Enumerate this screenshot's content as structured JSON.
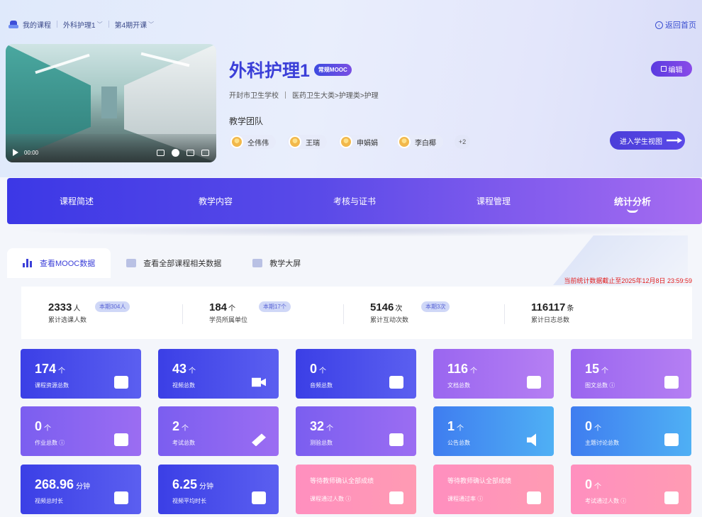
{
  "breadcrumb": {
    "my_courses": "我的课程",
    "course": "外科护理1",
    "term": "第4期开课",
    "back_home": "返回首页"
  },
  "video": {
    "time": "00:00"
  },
  "course": {
    "title": "外科护理1",
    "tag": "常规MOOC",
    "school": "开封市卫生学校",
    "category": "医药卫生大类>护理类>护理",
    "team_label": "教学团队",
    "members": [
      "仝伟伟",
      "王瑞",
      "申娟娟",
      "李白椰"
    ],
    "more_count": "+2",
    "edit_label": "编辑",
    "student_view_label": "进入学生视图"
  },
  "nav": {
    "items": [
      "课程简述",
      "教学内容",
      "考核与证书",
      "课程管理",
      "统计分析"
    ],
    "active_index": 4
  },
  "tabs": {
    "items": [
      "查看MOOC数据",
      "查看全部课程相关数据",
      "教学大屏"
    ],
    "active_index": 0
  },
  "stat_time": "当前统计数据截止至2025年12月8日 23:59:59",
  "summary": [
    {
      "value": "2333",
      "unit": "人",
      "label": "累计选课人数",
      "badge": "本期304人"
    },
    {
      "value": "184",
      "unit": "个",
      "label": "学员所属单位",
      "badge": "本期17个"
    },
    {
      "value": "5146",
      "unit": "次",
      "label": "累计互动次数",
      "badge": "本期3次"
    },
    {
      "value": "116117",
      "unit": "条",
      "label": "累计日志总数",
      "badge": ""
    }
  ],
  "cards": [
    {
      "value": "174",
      "unit": "个",
      "label": "课程资源总数",
      "theme": "blue",
      "icon": "pie-icon"
    },
    {
      "value": "43",
      "unit": "个",
      "label": "视频总数",
      "theme": "blue",
      "icon": "video-camera-icon"
    },
    {
      "value": "0",
      "unit": "个",
      "label": "音频总数",
      "theme": "blue",
      "icon": "music-note-icon"
    },
    {
      "value": "116",
      "unit": "个",
      "label": "文档总数",
      "theme": "violet",
      "icon": "word-doc-icon"
    },
    {
      "value": "15",
      "unit": "个",
      "label": "图文总数 ⓘ",
      "theme": "violet",
      "icon": "image-text-icon"
    },
    {
      "value": "0",
      "unit": "个",
      "label": "作业总数 ⓘ",
      "theme": "purple",
      "icon": "homework-edit-icon"
    },
    {
      "value": "2",
      "unit": "个",
      "label": "考试总数",
      "theme": "purple",
      "icon": "pen-icon"
    },
    {
      "value": "32",
      "unit": "个",
      "label": "测验总数",
      "theme": "purple",
      "icon": "quiz-clock-icon"
    },
    {
      "value": "1",
      "unit": "个",
      "label": "公告总数",
      "theme": "sky",
      "icon": "speaker-icon"
    },
    {
      "value": "0",
      "unit": "个",
      "label": "主题讨论总数",
      "theme": "sky",
      "icon": "discussion-icon"
    },
    {
      "value": "268.96",
      "unit": "分钟",
      "label": "视频总时长",
      "theme": "blue",
      "icon": "play-clapper-icon"
    },
    {
      "value": "6.25",
      "unit": "分钟",
      "label": "视频平均时长",
      "theme": "blue",
      "icon": "film-icon"
    },
    {
      "value": "",
      "unit": "",
      "text": "等待教师确认全部成绩",
      "label": "课程通过人数 ⓘ",
      "theme": "pink",
      "icon": "user-check-icon"
    },
    {
      "value": "",
      "unit": "",
      "text": "等待教师确认全部成绩",
      "label": "课程通过率 ⓘ",
      "theme": "pink",
      "icon": "pass-rate-icon"
    },
    {
      "value": "0",
      "unit": "个",
      "label": "考试通过人数 ⓘ",
      "theme": "pink",
      "icon": "exam-pass-icon"
    }
  ]
}
